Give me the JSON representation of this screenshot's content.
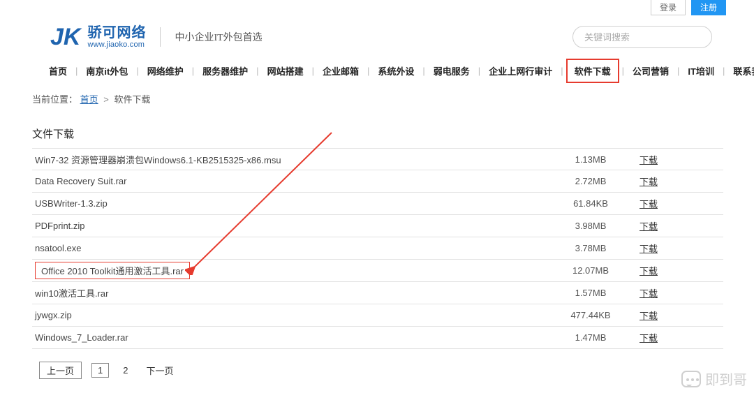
{
  "topbar": {
    "login": "登录",
    "register": "注册"
  },
  "logo": {
    "abbr": "JK",
    "cn": "骄可网络",
    "en": "www.jiaoko.com"
  },
  "tagline": "中小企业IT外包首选",
  "search": {
    "placeholder": "关键词搜索"
  },
  "nav": [
    "首页",
    "南京it外包",
    "网络维护",
    "服务器维护",
    "网站搭建",
    "企业邮箱",
    "系统外设",
    "弱电服务",
    "企业上网行审计",
    "软件下载",
    "公司营销",
    "IT培训",
    "联系我们"
  ],
  "nav_highlight_index": 9,
  "breadcrumb": {
    "label": "当前位置：",
    "home": "首页",
    "sep": ">",
    "current": "软件下载"
  },
  "section": {
    "title": "文件下载"
  },
  "dl_label": "下载",
  "files": [
    {
      "name": "Win7-32 资源管理器崩溃包Windows6.1-KB2515325-x86.msu",
      "size": "1.13MB"
    },
    {
      "name": "Data Recovery Suit.rar",
      "size": "2.72MB"
    },
    {
      "name": "USBWriter-1.3.zip",
      "size": "61.84KB"
    },
    {
      "name": "PDFprint.zip",
      "size": "3.98MB"
    },
    {
      "name": "nsatool.exe",
      "size": "3.78MB"
    },
    {
      "name": "Office 2010 Toolkit通用激活工具.rar",
      "size": "12.07MB"
    },
    {
      "name": "win10激活工具.rar",
      "size": "1.57MB"
    },
    {
      "name": "jywgx.zip",
      "size": "477.44KB"
    },
    {
      "name": "Windows_7_Loader.rar",
      "size": "1.47MB"
    }
  ],
  "highlight_file_index": 5,
  "pager": {
    "prev": "上一页",
    "p1": "1",
    "p2": "2",
    "next": "下一页"
  },
  "watermark": "即到哥"
}
